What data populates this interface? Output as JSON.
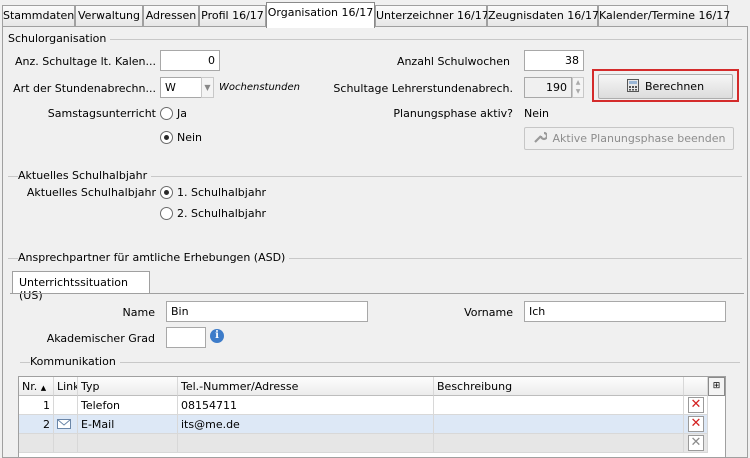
{
  "tabs": [
    {
      "label": "Stammdaten"
    },
    {
      "label": "Verwaltung"
    },
    {
      "label": "Adressen"
    },
    {
      "label": "Profil 16/17"
    },
    {
      "label": "Organisation 16/17",
      "active": true
    },
    {
      "label": "Unterzeichner 16/17"
    },
    {
      "label": "Zeugnisdaten 16/17"
    },
    {
      "label": "Kalender/Termine 16/17"
    }
  ],
  "schulorganisation": {
    "title": "Schulorganisation",
    "schultage_label": "Anz. Schultage lt. Kalen...",
    "schultage_value": "0",
    "stundenabrechnung_label": "Art der Stundenabrechn...",
    "stundenabrechnung_value": "W",
    "stundenabrechnung_hint": "Wochenstunden",
    "samstag_label": "Samstagsunterricht",
    "samstag_ja": "Ja",
    "samstag_nein": "Nein",
    "samstag_selected": "Nein",
    "schulwochen_label": "Anzahl  Schulwochen",
    "schulwochen_value": "38",
    "lehrerstunden_label": "Schultage Lehrerstundenabrech.",
    "lehrerstunden_value": "190",
    "berechnen_label": "Berechnen",
    "planungsphase_label": "Planungsphase aktiv?",
    "planungsphase_value": "Nein",
    "planungsphase_button": "Aktive Planungsphase beenden"
  },
  "halbjahr": {
    "title": "Aktuelles Schulhalbjahr",
    "label": "Aktuelles Schulhalbjahr",
    "option1": "1. Schulhalbjahr",
    "option2": "2. Schulhalbjahr",
    "selected": "1. Schulhalbjahr"
  },
  "asd": {
    "title": "Ansprechpartner für amtliche Erhebungen (ASD)",
    "subtab": "Unterrichtssituation (US)",
    "name_label": "Name",
    "name_value": "Bin",
    "vorname_label": "Vorname",
    "vorname_value": "Ich",
    "grad_label": "Akademischer Grad",
    "grad_value": "",
    "kommunikation_title": "Kommunikation",
    "columns": [
      "Nr.",
      "Link",
      "Typ",
      "Tel.-Nummer/Adresse",
      "Beschreibung"
    ],
    "rows": [
      {
        "nr": "1",
        "link": "",
        "typ": "Telefon",
        "adresse": "08154711",
        "beschreibung": ""
      },
      {
        "nr": "2",
        "link": "mail-icon",
        "typ": "E-Mail",
        "adresse": "its@me.de",
        "beschreibung": ""
      }
    ]
  },
  "colors": {
    "highlight": "#d42b2b",
    "selected_row": "#dde8f6"
  }
}
